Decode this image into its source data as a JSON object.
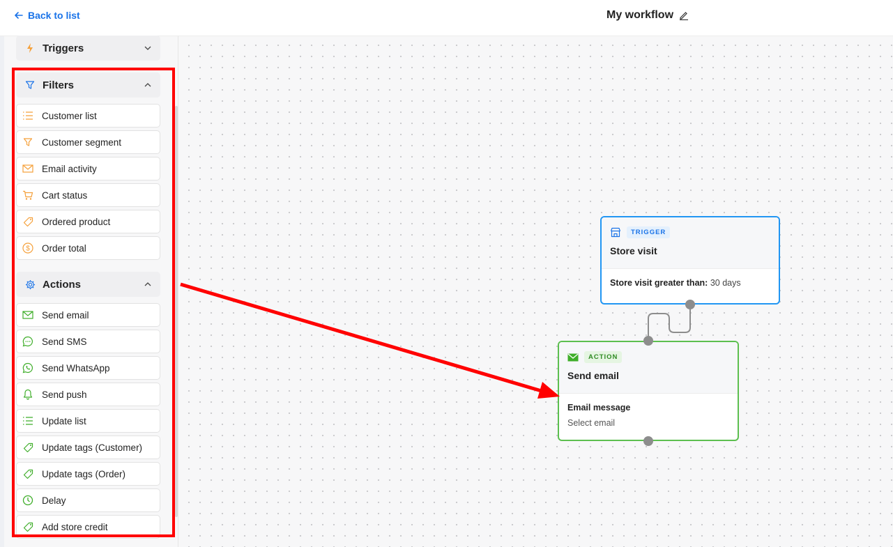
{
  "header": {
    "back_label": "Back to list",
    "title": "My workflow"
  },
  "sidebar": {
    "triggers": {
      "title": "Triggers",
      "icon": "lightning-icon",
      "expanded": false
    },
    "filters": {
      "title": "Filters",
      "icon": "filter-icon",
      "expanded": true,
      "items": [
        {
          "label": "Customer list",
          "icon": "list-icon"
        },
        {
          "label": "Customer segment",
          "icon": "funnel-icon"
        },
        {
          "label": "Email activity",
          "icon": "envelope-icon"
        },
        {
          "label": "Cart status",
          "icon": "cart-icon"
        },
        {
          "label": "Ordered product",
          "icon": "tag-icon"
        },
        {
          "label": "Order total",
          "icon": "dollar-icon"
        }
      ]
    },
    "actions": {
      "title": "Actions",
      "icon": "gear-icon",
      "expanded": true,
      "items": [
        {
          "label": "Send email",
          "icon": "envelope-icon"
        },
        {
          "label": "Send SMS",
          "icon": "chat-icon"
        },
        {
          "label": "Send WhatsApp",
          "icon": "whatsapp-icon"
        },
        {
          "label": "Send push",
          "icon": "bell-icon"
        },
        {
          "label": "Update list",
          "icon": "list-icon"
        },
        {
          "label": "Update tags (Customer)",
          "icon": "tag-icon"
        },
        {
          "label": "Update tags (Order)",
          "icon": "tag-icon"
        },
        {
          "label": "Delay",
          "icon": "clock-icon"
        },
        {
          "label": "Add store credit",
          "icon": "tag-icon"
        }
      ]
    }
  },
  "canvas": {
    "trigger_node": {
      "badge": "TRIGGER",
      "title": "Store visit",
      "condition_label": "Store visit greater than:",
      "condition_value": "30 days",
      "icon": "store-icon"
    },
    "action_node": {
      "badge": "ACTION",
      "title": "Send email",
      "field_label": "Email message",
      "field_value": "Select email",
      "icon": "envelope-icon"
    }
  },
  "colors": {
    "accent_blue": "#1a73e8",
    "trigger_border": "#2196f3",
    "action_border": "#5cbf4f",
    "filter_icon": "#f5a03a",
    "action_icon": "#3fae2a",
    "annotation_red": "#ff0000"
  }
}
